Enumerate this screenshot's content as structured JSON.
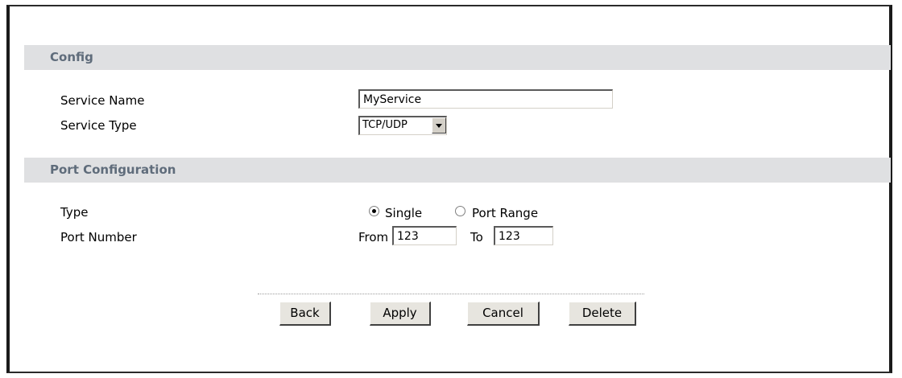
{
  "config": {
    "header": "Config",
    "service_name": {
      "label": "Service Name",
      "value": "MyService"
    },
    "service_type": {
      "label": "Service Type",
      "selected": "TCP/UDP"
    }
  },
  "port_config": {
    "header": "Port Configuration",
    "type": {
      "label": "Type",
      "options": [
        {
          "label": "Single",
          "checked": true
        },
        {
          "label": "Port Range",
          "checked": false
        }
      ]
    },
    "port_number": {
      "label": "Port Number",
      "from_label": "From",
      "from_value": "123",
      "to_label": "To",
      "to_value": "123"
    }
  },
  "buttons": {
    "back": "Back",
    "apply": "Apply",
    "cancel": "Cancel",
    "delete": "Delete"
  }
}
